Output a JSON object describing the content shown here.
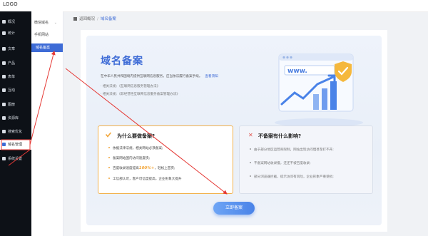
{
  "topbar": {
    "logo": "LOGO"
  },
  "sidebar": {
    "items": [
      {
        "label": "概况",
        "icon": "home-icon"
      },
      {
        "label": "统计",
        "icon": "chart-icon"
      },
      {
        "label": "文章",
        "icon": "article-icon"
      },
      {
        "label": "产品",
        "icon": "product-icon"
      },
      {
        "label": "表单",
        "icon": "form-icon"
      },
      {
        "label": "互动",
        "icon": "chat-icon"
      },
      {
        "label": "图册",
        "icon": "gallery-icon"
      },
      {
        "label": "资源库",
        "icon": "library-icon"
      },
      {
        "label": "搜索优化",
        "icon": "seo-icon"
      },
      {
        "label": "域名管理",
        "icon": "domain-icon"
      },
      {
        "label": "系统设置",
        "icon": "gear-icon"
      }
    ]
  },
  "subnav": {
    "items": [
      {
        "label": "微信域名"
      },
      {
        "label": "手机网站"
      },
      {
        "label": "域名备案"
      }
    ]
  },
  "breadcrumb": {
    "home": "返回概况",
    "current": "域名备案"
  },
  "hero": {
    "title": "域名备案",
    "desc": "在中华人民共和国境内提供互联网信息服务，应当依法履行备案手续。",
    "desc_link": "查看须知",
    "laws": [
      "相关法规：《互联网信息服务管理办法》",
      "相关法规：《非经营性互联网信息服务备案管理办法》"
    ],
    "illus_text": "www."
  },
  "why": {
    "title": "为什么要做备案?",
    "points": [
      "依据法律法规，相关网站必须备案;",
      "备案网站国内访问速度快;",
      "百度收录速度提高",
      "工信部认可，客户可信度提高，企业形象大提升"
    ],
    "highlight": "100%+",
    "highlight_suffix": "，轻松上首页;"
  },
  "whynot": {
    "title": "不备案有什么影响?",
    "points": [
      "由于部分地区运营商限制，网站出现访问慢甚至打不开;",
      "不备案网站收录慢，还还不被百度收录;",
      "部分浏览器拦截，提示访问有风险，企业形象严重受损;"
    ]
  },
  "cta": {
    "label": "立即备案"
  },
  "colors": {
    "accent": "#3d6bd6",
    "warn": "#f2a63a",
    "danger": "#e0504a",
    "annotation": "#e53935"
  }
}
